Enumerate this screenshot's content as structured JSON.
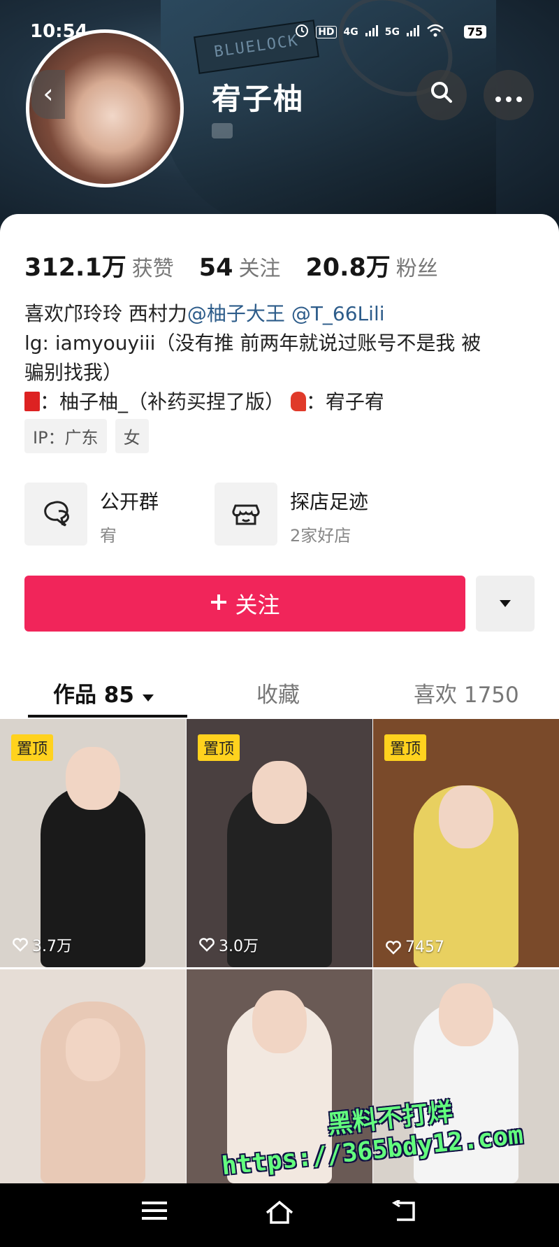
{
  "status_bar": {
    "time": "10:54",
    "hd_label": "HD",
    "net1": "4G",
    "net2": "5G",
    "battery": "75"
  },
  "header": {
    "back_icon": "chevron-left-icon",
    "name": "宥子柚",
    "search_icon": "search-icon",
    "more_icon": "more-horizontal-icon",
    "cover_text": "BLUELOCK"
  },
  "stats": [
    {
      "value": "312.1万",
      "label": "获赞"
    },
    {
      "value": "54",
      "label": "关注"
    },
    {
      "value": "20.8万",
      "label": "粉丝"
    }
  ],
  "bio": {
    "line1_text": "喜欢邝玲玲 西村力",
    "mention1": "@柚子大王",
    "mention2": "@T_66Lili",
    "line2": "lg: iamyouyiii（没有推 前两年就说过账号不是我 被",
    "line3": "骗别找我）",
    "line4_a": "：柚子柚_（补药买捏了版）",
    "line4_b": "：宥子宥"
  },
  "tags": [
    "IP：广东",
    "女"
  ],
  "features": [
    {
      "title": "公开群",
      "subtitle": "宥",
      "icon": "group-chat-icon"
    },
    {
      "title": "探店足迹",
      "subtitle": "2家好店",
      "icon": "store-icon"
    }
  ],
  "follow_button": {
    "label": "关注",
    "icon": "plus-icon"
  },
  "dropdown_icon": "caret-down-icon",
  "tabs": [
    {
      "label": "作品 85",
      "active": true
    },
    {
      "label": "收藏",
      "active": false
    },
    {
      "label": "喜欢 1750",
      "active": false
    }
  ],
  "videos": [
    {
      "pinned": true,
      "pin_label": "置顶",
      "likes": "3.7万",
      "bg": "#d9d3cc",
      "outfit": "#1a1a1a"
    },
    {
      "pinned": true,
      "pin_label": "置顶",
      "likes": "3.0万",
      "bg": "#4a4040",
      "outfit": "#222222"
    },
    {
      "pinned": true,
      "pin_label": "置顶",
      "likes": "7457",
      "bg": "#7a4a2a",
      "outfit": "#e8d060"
    },
    {
      "pinned": false,
      "pin_label": "",
      "likes": "",
      "bg": "#e6ddd6",
      "outfit": "#e8c9b6"
    },
    {
      "pinned": false,
      "pin_label": "",
      "likes": "",
      "bg": "#6a5a55",
      "outfit": "#f2e8e0"
    },
    {
      "pinned": false,
      "pin_label": "",
      "likes": "",
      "bg": "#d8d2cb",
      "outfit": "#f4f4f4"
    }
  ],
  "watermark": {
    "line1": "黑料不打烊",
    "line2": "https://365bdy12.com"
  },
  "nav_bar": {
    "menu_icon": "menu-icon",
    "home_icon": "home-icon",
    "back_icon": "back-icon"
  }
}
